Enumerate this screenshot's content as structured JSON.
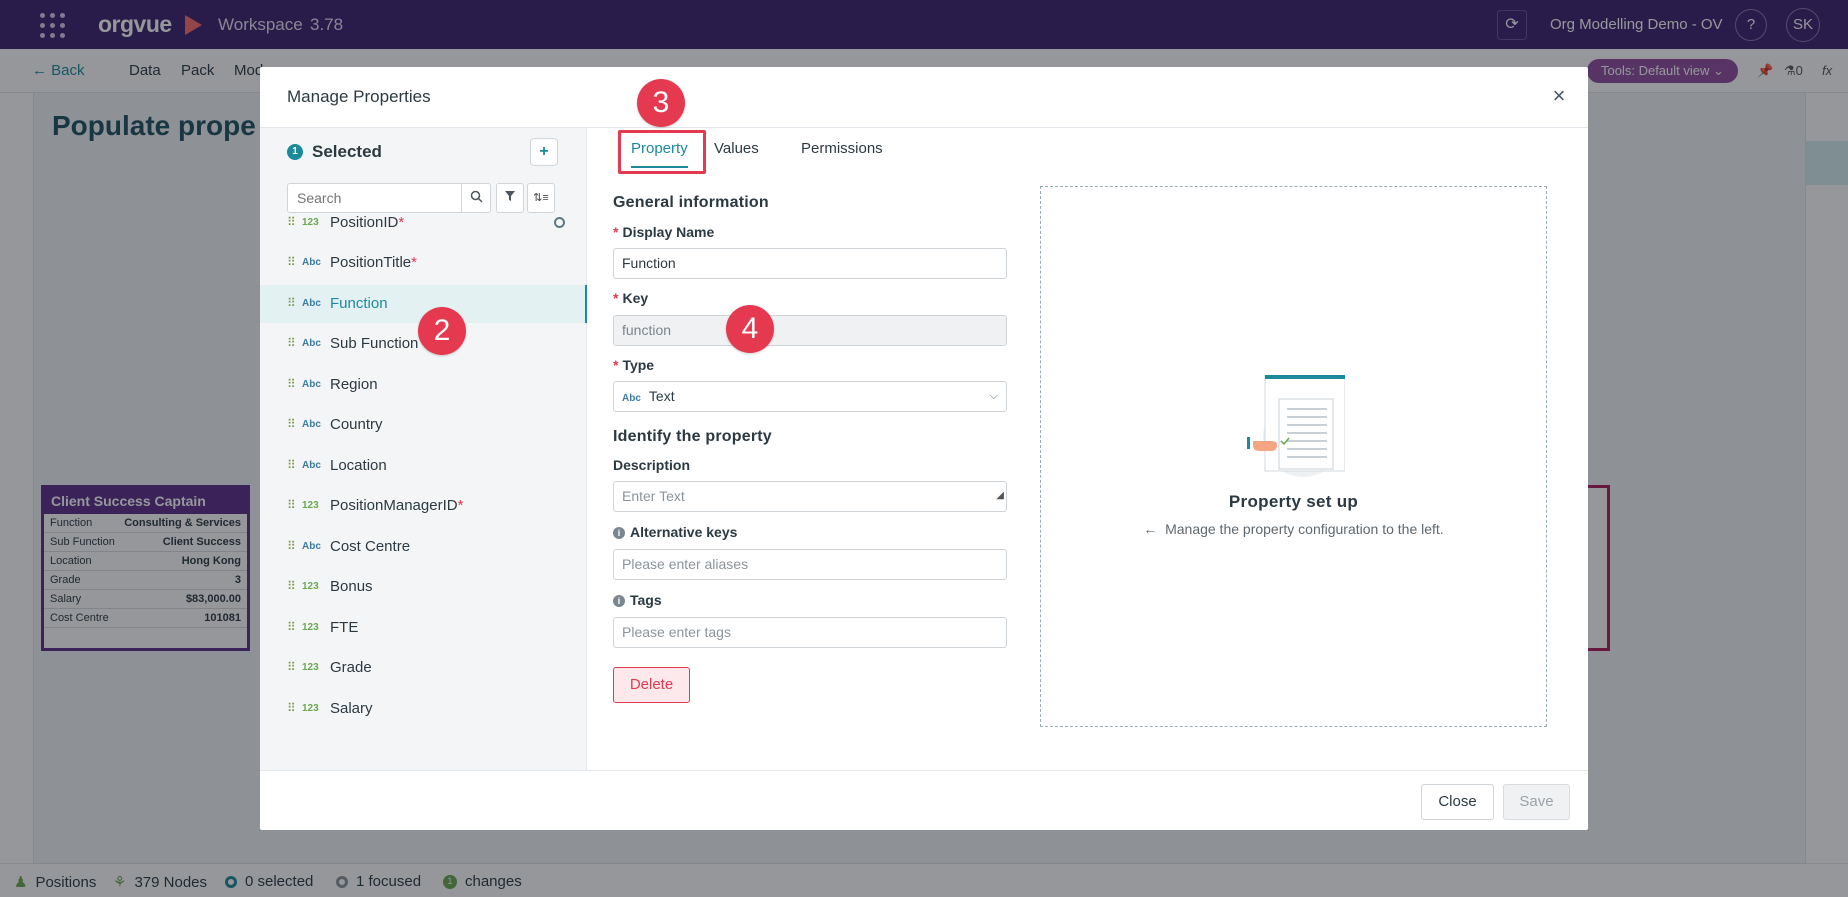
{
  "app": {
    "brand": "orgvue",
    "workspace": "Workspace",
    "version": "3.78",
    "org_name": "Org Modelling Demo - OV",
    "help": "?",
    "avatar": "SK"
  },
  "subbar": {
    "back": "Back",
    "menu": [
      "Data",
      "Pack",
      "Mod"
    ],
    "tools": "Tools: Default view",
    "count": "0"
  },
  "canvas": {
    "title": "Populate prope",
    "card": {
      "title": "Client Success Captain",
      "rows": [
        {
          "label": "Function",
          "value": "Consulting & Services"
        },
        {
          "label": "Sub Function",
          "value": "Client Success"
        },
        {
          "label": "Location",
          "value": "Hong Kong"
        },
        {
          "label": "Grade",
          "value": "3"
        },
        {
          "label": "Salary",
          "value": "$83,000.00"
        },
        {
          "label": "Cost Centre",
          "value": "101081"
        }
      ]
    }
  },
  "statusbar": {
    "positions": "Positions",
    "nodes": "379 Nodes",
    "selected": "0 selected",
    "focused": "1 focused",
    "changes_count": "1",
    "changes": "changes"
  },
  "modal": {
    "title": "Manage Properties",
    "close": "×",
    "selected_count": "1",
    "selected_label": "Selected",
    "search_placeholder": "Search",
    "properties": [
      {
        "type": "123",
        "name": "PositionID",
        "required": "*"
      },
      {
        "type": "Abc",
        "name": "PositionTitle",
        "required": "*"
      },
      {
        "type": "Abc",
        "name": "Function",
        "required": ""
      },
      {
        "type": "Abc",
        "name": "Sub Function",
        "required": ""
      },
      {
        "type": "Abc",
        "name": "Region",
        "required": ""
      },
      {
        "type": "Abc",
        "name": "Country",
        "required": ""
      },
      {
        "type": "Abc",
        "name": "Location",
        "required": ""
      },
      {
        "type": "123",
        "name": "PositionManagerID",
        "required": "*"
      },
      {
        "type": "Abc",
        "name": "Cost Centre",
        "required": ""
      },
      {
        "type": "123",
        "name": "Bonus",
        "required": ""
      },
      {
        "type": "123",
        "name": "FTE",
        "required": ""
      },
      {
        "type": "123",
        "name": "Grade",
        "required": ""
      },
      {
        "type": "123",
        "name": "Salary",
        "required": ""
      }
    ],
    "tabs": [
      "Property",
      "Values",
      "Permissions"
    ],
    "general_title": "General information",
    "display_name_label": "Display Name",
    "display_name_value": "Function",
    "key_label": "Key",
    "key_value": "function",
    "type_label": "Type",
    "type_badge": "Abc",
    "type_value": "Text",
    "identify_title": "Identify the property",
    "description_label": "Description",
    "description_placeholder": "Enter Text",
    "alt_keys_label": "Alternative keys",
    "alt_keys_placeholder": "Please enter aliases",
    "tags_label": "Tags",
    "tags_placeholder": "Please enter tags",
    "delete": "Delete",
    "setup_title": "Property set up",
    "setup_sub": "Manage the property configuration to the left.",
    "btn_close": "Close",
    "btn_save": "Save",
    "required_star": "*"
  },
  "callouts": [
    "2",
    "3",
    "4"
  ],
  "colors": {
    "brand": "#3d1f6e",
    "accent": "#1a8a9c",
    "danger": "#e53950"
  }
}
